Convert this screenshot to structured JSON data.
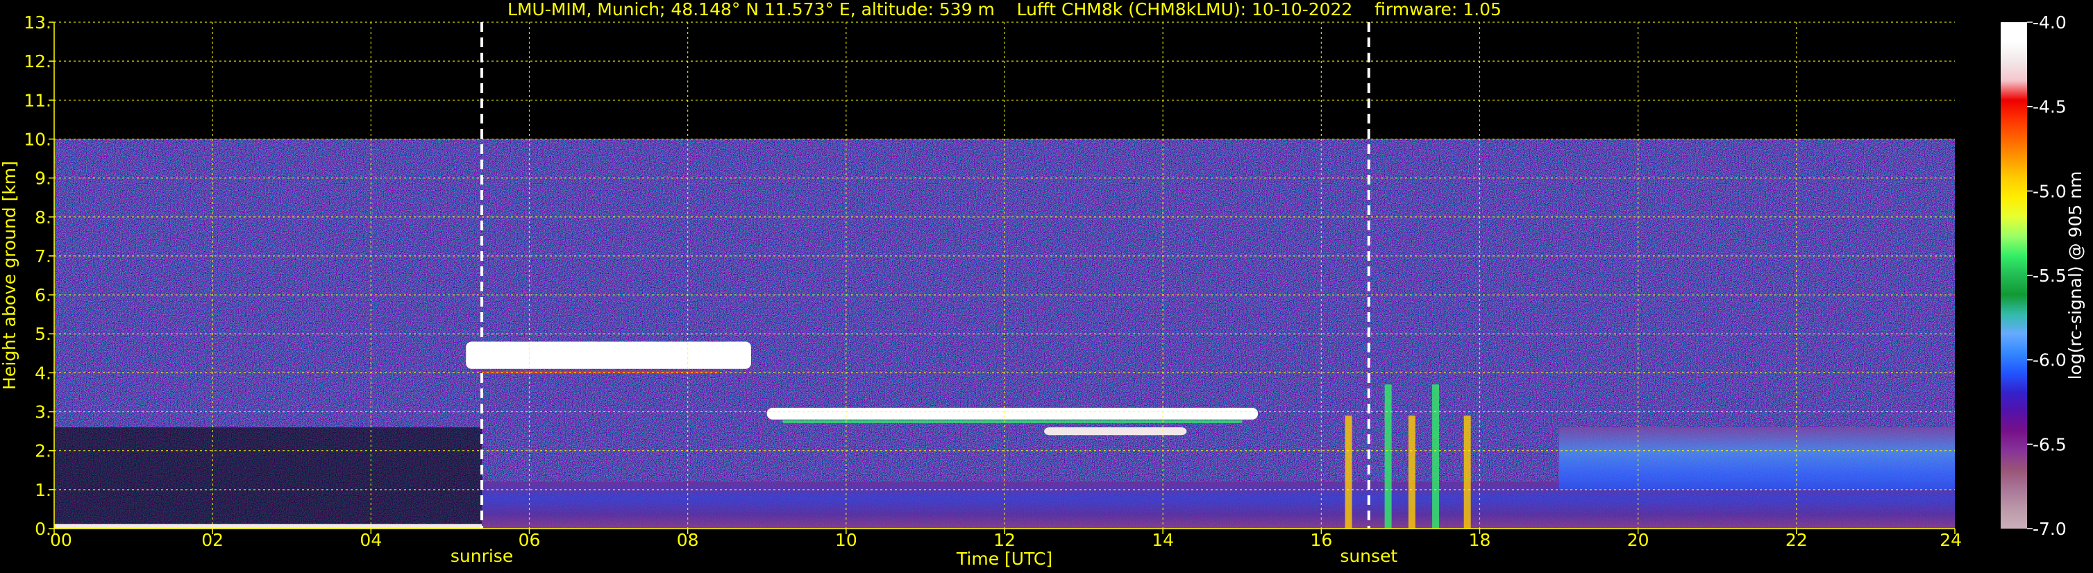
{
  "chart_data": {
    "type": "heatmap",
    "title": "LMU-MIM, Munich; 48.148° N 11.573° E, altitude: 539 m    Lufft CHM8k (CHM8kLMU): 10-10-2022    firmware: 1.05",
    "xlabel": "Time [UTC]",
    "ylabel": "Height above ground [km]",
    "xlim": [
      0,
      24
    ],
    "ylim": [
      0,
      13
    ],
    "x_ticks": [
      "00",
      "02",
      "04",
      "06",
      "08",
      "10",
      "12",
      "14",
      "16",
      "18",
      "20",
      "22",
      "24"
    ],
    "y_ticks": [
      "0.",
      "1.",
      "2.",
      "3.",
      "4.",
      "5.",
      "6.",
      "7.",
      "8.",
      "9.",
      "10.",
      "11.",
      "12.",
      "13."
    ],
    "grid": true,
    "data_top_km": 10.0,
    "events": [
      {
        "label": "sunrise",
        "time_h": 5.4
      },
      {
        "label": "sunset",
        "time_h": 16.6
      }
    ],
    "colorbar": {
      "label": "log(rc-signal) @ 905 nm",
      "range": [
        -7.0,
        -4.0
      ],
      "ticks": [
        "-4.0",
        "-4.5",
        "-5.0",
        "-5.5",
        "-6.0",
        "-6.5",
        "-7.0"
      ],
      "colors": [
        "#ffffff",
        "#ffffff",
        "#f2e8ea",
        "#f4c6cc",
        "#ee0000",
        "#ff3300",
        "#ff6600",
        "#ff9900",
        "#ffcc00",
        "#ffee00",
        "#e6ff33",
        "#99ff66",
        "#33ee66",
        "#22bb55",
        "#119933",
        "#33bbaa",
        "#66aaff",
        "#3388ff",
        "#2255ff",
        "#3322cc",
        "#5511aa",
        "#771188",
        "#883399",
        "#995577",
        "#aa7799",
        "#bb99aa",
        "#ccb0bb"
      ]
    },
    "features": [
      {
        "name": "surface layer",
        "t": [
          0.0,
          5.4
        ],
        "z": [
          0.0,
          0.12
        ],
        "level": -4.2
      },
      {
        "name": "cloud layer",
        "t": [
          5.2,
          8.8
        ],
        "z": [
          4.1,
          4.8
        ],
        "level": -4.0
      },
      {
        "name": "cloud layer",
        "t": [
          9.0,
          15.2
        ],
        "z": [
          2.8,
          3.1
        ],
        "level": -4.1
      },
      {
        "name": "cloud layer",
        "t": [
          12.5,
          14.3
        ],
        "z": [
          2.4,
          2.6
        ],
        "level": -4.2
      },
      {
        "name": "boundary layer",
        "t": [
          5.4,
          24.0
        ],
        "z": [
          0.0,
          1.2
        ],
        "level": -6.3
      },
      {
        "name": "residual layer",
        "t": [
          19.0,
          24.0
        ],
        "z": [
          1.0,
          2.6
        ],
        "level": -6.5
      }
    ]
  }
}
